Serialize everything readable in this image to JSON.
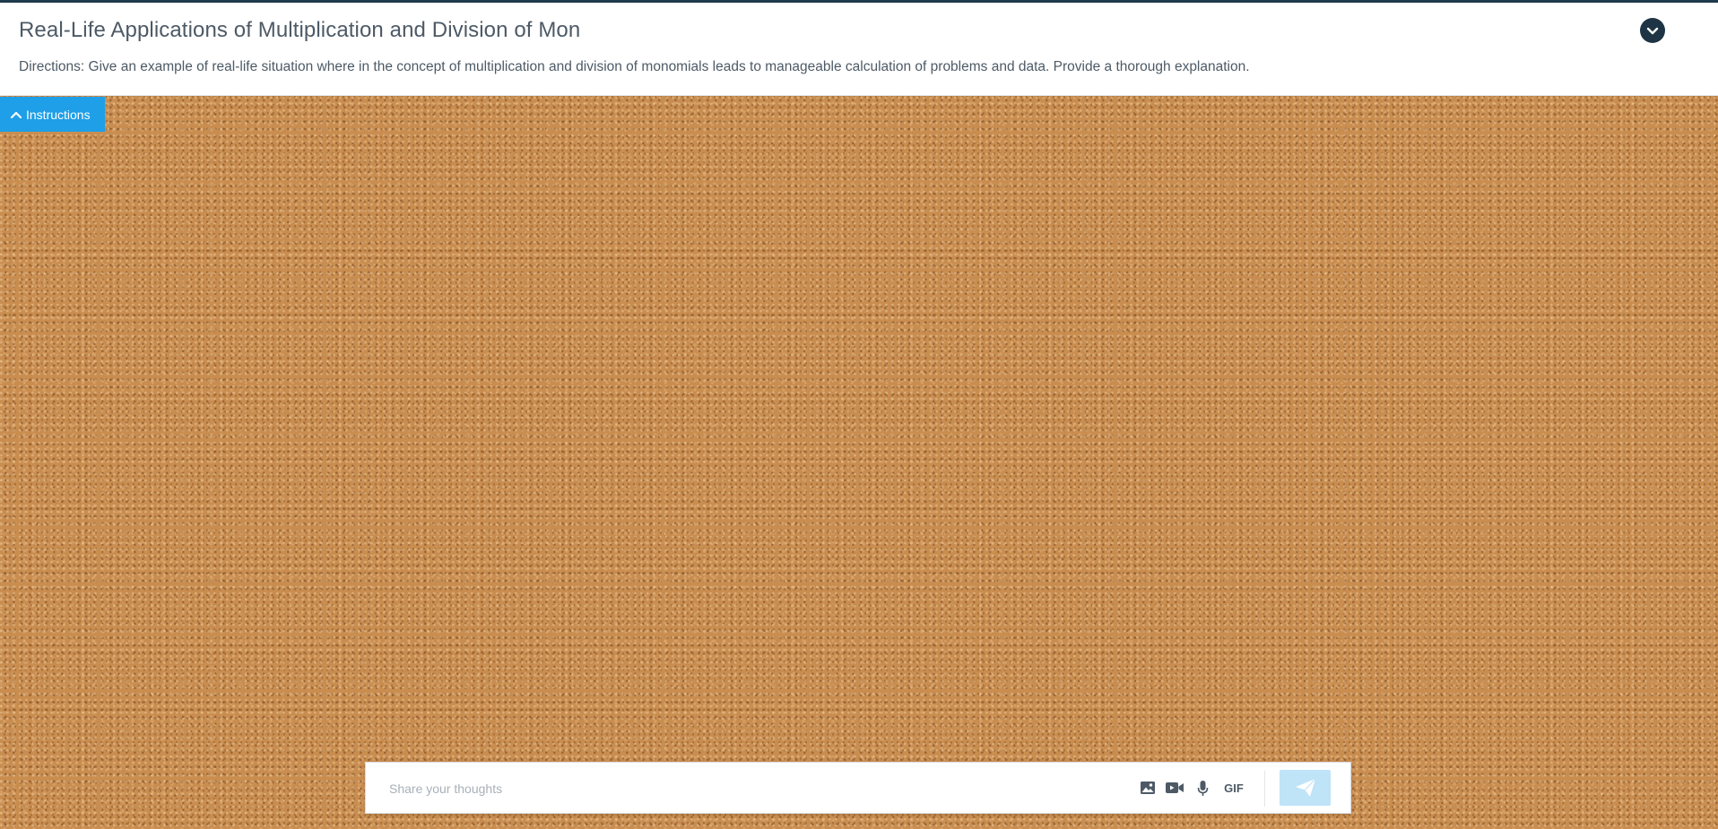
{
  "header": {
    "title": "Real-Life Applications of Multiplication and Division of Mon",
    "directions": "Directions: Give an example of real-life situation where in the concept of multiplication and division of monomials leads to manageable calculation of problems and data. Provide a thorough explanation.",
    "collapse_icon": "chevron-down-icon"
  },
  "instructions_tab": {
    "label": "Instructions",
    "icon": "chevron-up-icon"
  },
  "composer": {
    "placeholder": "Share your thoughts",
    "value": "",
    "tools": {
      "image_icon": "image-icon",
      "video_icon": "video-icon",
      "mic_icon": "microphone-icon",
      "gif_label": "GIF"
    },
    "send_icon": "paper-plane-icon"
  },
  "colors": {
    "accent": "#1e9fe8",
    "header_dark": "#1e3444",
    "send_disabled": "#bfe3f7",
    "text": "#4d5a66",
    "corkboard": "#c98d50"
  }
}
